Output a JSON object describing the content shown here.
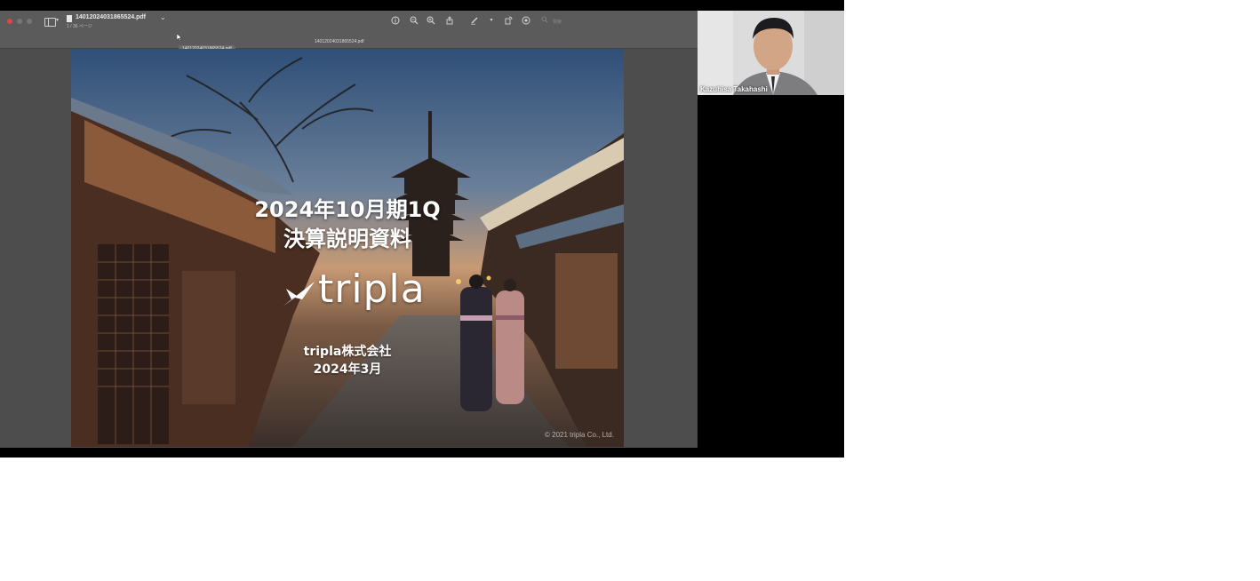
{
  "pdf_viewer": {
    "file_title": "14012024031865524.pdf",
    "file_subtitle": "1 / 36 ページ",
    "tab_filename": "14012024031865524.pdf",
    "tooltip": "14012024031865524.pdf",
    "search_placeholder": "検索",
    "icons": [
      "info-icon",
      "zoom-out-icon",
      "zoom-in-icon",
      "share-icon",
      "markup-pen-icon",
      "rotate-icon",
      "annotate-icon",
      "search-icon"
    ]
  },
  "slide": {
    "title_line1": "2024年10月期1Q",
    "title_line2": "決算説明資料",
    "logo_text": "tripla",
    "company_name": "tripla株式会社",
    "date": "2024年3月",
    "copyright": "© 2021 tripla Co., Ltd."
  },
  "participant": {
    "name": "Kazuhisa Takahashi"
  }
}
